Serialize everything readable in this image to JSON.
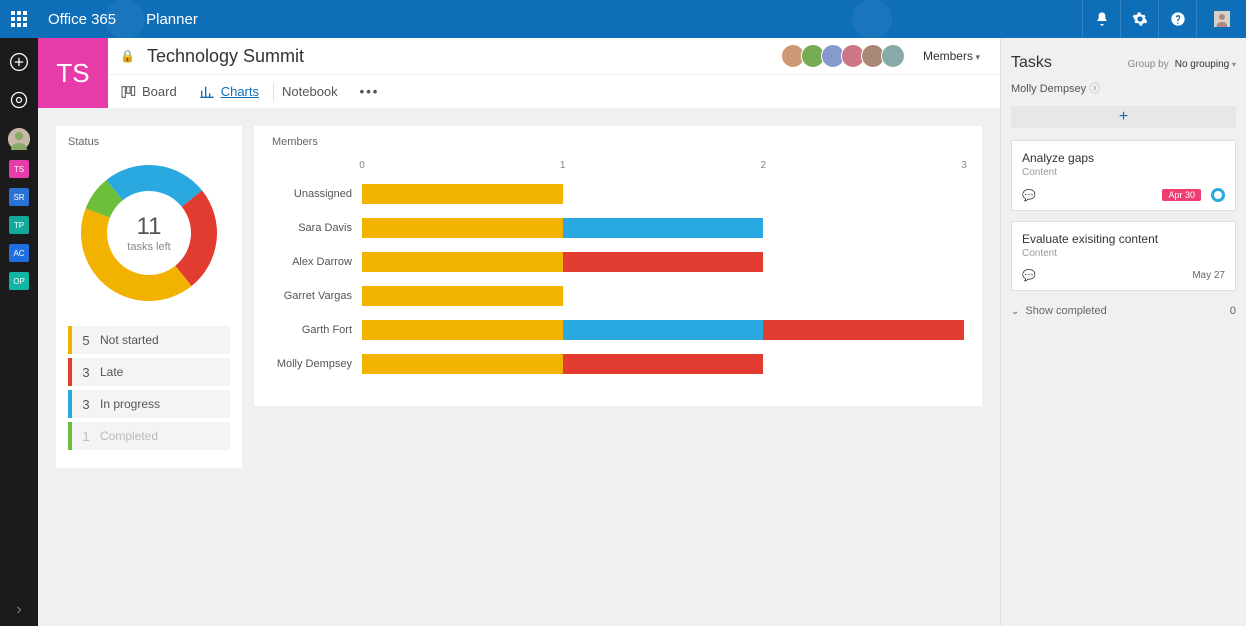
{
  "suite": {
    "brand": "Office 365",
    "app": "Planner"
  },
  "leftRail": {
    "plans": [
      {
        "initials": "TS",
        "color": "#e63ba9"
      },
      {
        "initials": "SR",
        "color": "#2a72d4"
      },
      {
        "initials": "TP",
        "color": "#17a a"
      },
      {
        "initials": "AC",
        "color": "#1f6fe0"
      },
      {
        "initials": "OP",
        "color": "#11b5a3"
      }
    ]
  },
  "plan": {
    "initials": "TS",
    "color": "#e63ba9",
    "title": "Technology Summit",
    "membersLabel": "Members",
    "tabs": {
      "board": "Board",
      "charts": "Charts",
      "notebook": "Notebook"
    }
  },
  "status": {
    "title": "Status",
    "tasksLeft": 11,
    "tasksLeftLabel": "tasks left",
    "legend": [
      {
        "label": "Not started",
        "count": 5,
        "color": "#f2b200"
      },
      {
        "label": "Late",
        "count": 3,
        "color": "#e13c2f"
      },
      {
        "label": "In progress",
        "count": 3,
        "color": "#2aa8e0"
      },
      {
        "label": "Completed",
        "count": 1,
        "color": "#6cbf3a",
        "muted": true
      }
    ]
  },
  "membersChart": {
    "title": "Members",
    "axis": [
      0,
      1,
      2,
      3
    ],
    "rows": [
      {
        "name": "Unassigned",
        "notStarted": 1,
        "inProgress": 0,
        "late": 0
      },
      {
        "name": "Sara Davis",
        "notStarted": 1,
        "inProgress": 1,
        "late": 0
      },
      {
        "name": "Alex Darrow",
        "notStarted": 1,
        "inProgress": 0,
        "late": 1
      },
      {
        "name": "Garret Vargas",
        "notStarted": 1,
        "inProgress": 0,
        "late": 0
      },
      {
        "name": "Garth Fort",
        "notStarted": 1,
        "inProgress": 1,
        "late": 1
      },
      {
        "name": "Molly Dempsey",
        "notStarted": 1,
        "inProgress": 0,
        "late": 1
      }
    ]
  },
  "tasksPanel": {
    "title": "Tasks",
    "groupByLabel": "Group by",
    "groupByValue": "No grouping",
    "filterPerson": "Molly Dempsey",
    "cards": [
      {
        "title": "Analyze gaps",
        "sub": "Content",
        "due": "Apr 30",
        "overdue": true,
        "inProgress": true
      },
      {
        "title": "Evaluate exisiting content",
        "sub": "Content",
        "due": "May 27",
        "overdue": false,
        "inProgress": false
      }
    ],
    "showCompleted": "Show completed",
    "completedCount": 0
  },
  "chart_data": [
    {
      "type": "pie",
      "title": "Status",
      "categories": [
        "Not started",
        "Late",
        "In progress",
        "Completed"
      ],
      "values": [
        5,
        3,
        3,
        1
      ],
      "colors": [
        "#f2b200",
        "#e13c2f",
        "#2aa8e0",
        "#6cbf3a"
      ],
      "center_label": "11 tasks left"
    },
    {
      "type": "bar",
      "title": "Members",
      "orientation": "horizontal",
      "stacked": true,
      "xlabel": "",
      "ylabel": "",
      "xlim": [
        0,
        3
      ],
      "x_ticks": [
        0,
        1,
        2,
        3
      ],
      "categories": [
        "Unassigned",
        "Sara Davis",
        "Alex Darrow",
        "Garret Vargas",
        "Garth Fort",
        "Molly Dempsey"
      ],
      "series": [
        {
          "name": "Not started",
          "color": "#f2b200",
          "values": [
            1,
            1,
            1,
            1,
            1,
            1
          ]
        },
        {
          "name": "In progress",
          "color": "#2aa8e0",
          "values": [
            0,
            1,
            0,
            0,
            1,
            0
          ]
        },
        {
          "name": "Late",
          "color": "#e13c2f",
          "values": [
            0,
            0,
            1,
            0,
            1,
            1
          ]
        }
      ]
    }
  ]
}
